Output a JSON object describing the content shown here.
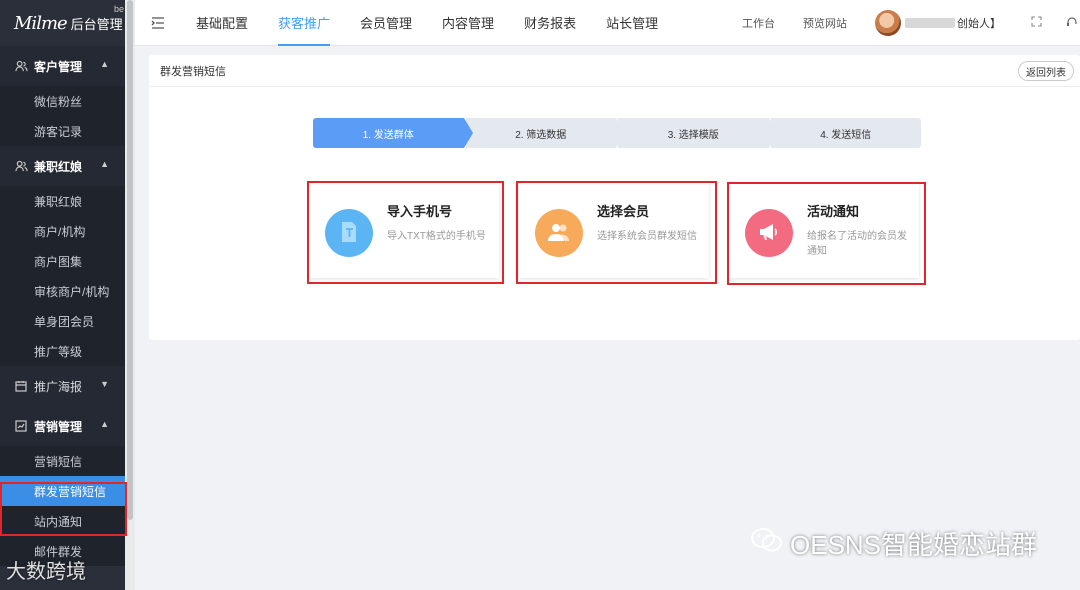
{
  "logo": {
    "script": "Milme",
    "title": "后台管理",
    "sup": "be"
  },
  "sidebar": {
    "groups": [
      {
        "label": "客户管理",
        "items": [
          "微信粉丝",
          "游客记录"
        ]
      },
      {
        "label": "兼职红娘",
        "items": [
          "兼职红娘",
          "商户/机构",
          "商户图集",
          "审核商户/机构",
          "单身团会员",
          "推广等级"
        ]
      },
      {
        "label": "推广海报",
        "items": []
      },
      {
        "label": "营销管理",
        "items": [
          "营销短信",
          "群发营销短信",
          "站内通知",
          "邮件群发"
        ]
      }
    ]
  },
  "nav": {
    "items": [
      "基础配置",
      "获客推广",
      "会员管理",
      "内容管理",
      "财务报表",
      "站长管理"
    ],
    "workbench": "工作台",
    "preview": "预览网站",
    "user_suffix": "创始人】"
  },
  "panel": {
    "title": "群发营销短信",
    "back": "返回列表",
    "steps": [
      "1. 发送群体",
      "2. 筛选数据",
      "3. 选择模版",
      "4. 发送短信"
    ],
    "cards": [
      {
        "title": "导入手机号",
        "desc": "导入TXT格式的手机号",
        "color": "#5bb5f5",
        "icon": "document-icon"
      },
      {
        "title": "选择会员",
        "desc": "选择系统会员群发短信",
        "color": "#f6aa5a",
        "icon": "users-icon"
      },
      {
        "title": "活动通知",
        "desc": "给报名了活动的会员发通知",
        "color": "#f26b80",
        "icon": "megaphone-icon"
      }
    ]
  },
  "watermark": {
    "main": "OESNS智能婚恋站群",
    "corner": "大数跨境"
  }
}
